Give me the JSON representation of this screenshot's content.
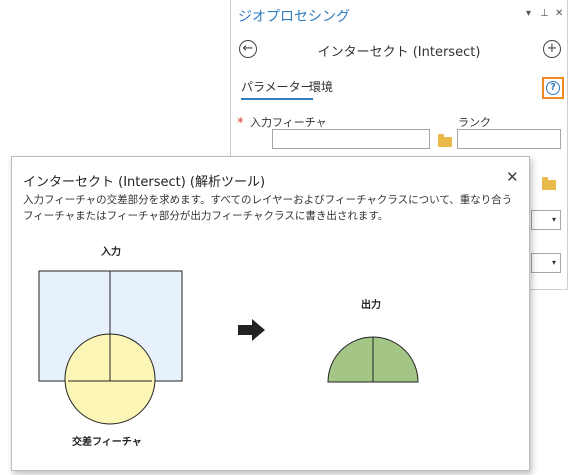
{
  "gp_pane": {
    "title": "ジオプロセシング",
    "pin_menu_glyph": "▾",
    "pin_glyph": "⊥",
    "close_glyph": "✕",
    "tool_title": "インターセクト (Intersect)",
    "back_glyph": "←",
    "add_glyph": "+",
    "tabs": [
      {
        "label": "パラメーター",
        "active": true
      },
      {
        "label": "環境",
        "active": false
      }
    ],
    "help_glyph": "?",
    "required_marker": "*",
    "params": {
      "input_features_label": "入力フィーチャ",
      "rank_label": "ランク"
    },
    "dropdown_glyph": "▾"
  },
  "popup": {
    "title": "インターセクト (Intersect) (解析ツール)",
    "close_glyph": "✕",
    "description": "入力フィーチャの交差部分を求めます。すべてのレイヤーおよびフィーチャクラスについて、重なり合うフィーチャまたはフィーチャ部分が出力フィーチャクラスに書き出されます。",
    "figure": {
      "input_label": "入力",
      "intersect_features_label": "交差フィーチャ",
      "output_label": "出力"
    }
  },
  "colors": {
    "accent_blue": "#2f7cbf",
    "help_highlight": "#f08a24",
    "required_red": "#d9342b",
    "input_rect_fill": "#e6f1fb",
    "intersect_circle_fill": "#fbf5b6",
    "output_fill": "#a3c585",
    "folder": "#e9b949"
  },
  "icons": [
    "back-arrow-icon",
    "add-icon",
    "help-icon",
    "folder-icon",
    "close-icon",
    "arrow-right-icon",
    "dropdown-chevron-icon"
  ]
}
